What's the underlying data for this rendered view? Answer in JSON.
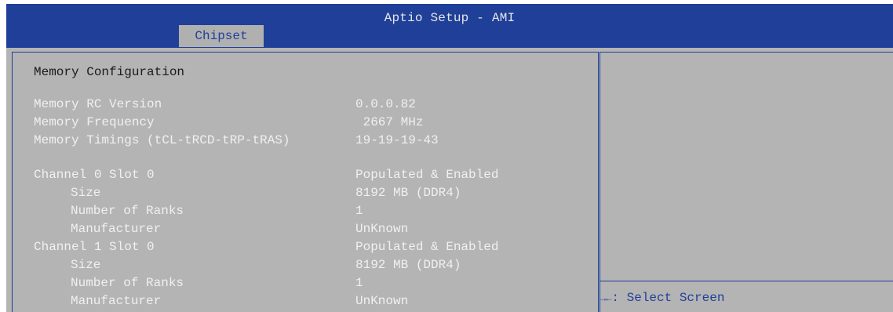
{
  "window": {
    "title": "Aptio Setup - AMI"
  },
  "tabs": [
    {
      "label": "Chipset",
      "active": true
    }
  ],
  "main": {
    "heading": "Memory Configuration",
    "rows": [
      {
        "label": "Memory RC Version",
        "value": "0.0.0.82"
      },
      {
        "label": "Memory Frequency",
        "value": " 2667 MHz"
      },
      {
        "label": "Memory Timings (tCL-tRCD-tRP-tRAS)",
        "value": "19-19-19-43"
      },
      {
        "label": "Channel 0 Slot 0",
        "value": "Populated & Enabled"
      },
      {
        "label": "Size",
        "value": "8192 MB (DDR4)"
      },
      {
        "label": "Number of Ranks",
        "value": "1"
      },
      {
        "label": "Manufacturer",
        "value": "UnKnown"
      },
      {
        "label": "Channel 1 Slot 0",
        "value": "Populated & Enabled"
      },
      {
        "label": "Size",
        "value": "8192 MB (DDR4)"
      },
      {
        "label": "Number of Ranks",
        "value": "1"
      },
      {
        "label": "Manufacturer",
        "value": "UnKnown"
      }
    ]
  },
  "help": {
    "arrows": "→←",
    "text": ": Select Screen"
  },
  "colors": {
    "title_bar": "#1f3f99",
    "panel_gray": "#b4b4b4",
    "value_text": "#f0f0f0",
    "accent_blue": "#1f3f99"
  }
}
